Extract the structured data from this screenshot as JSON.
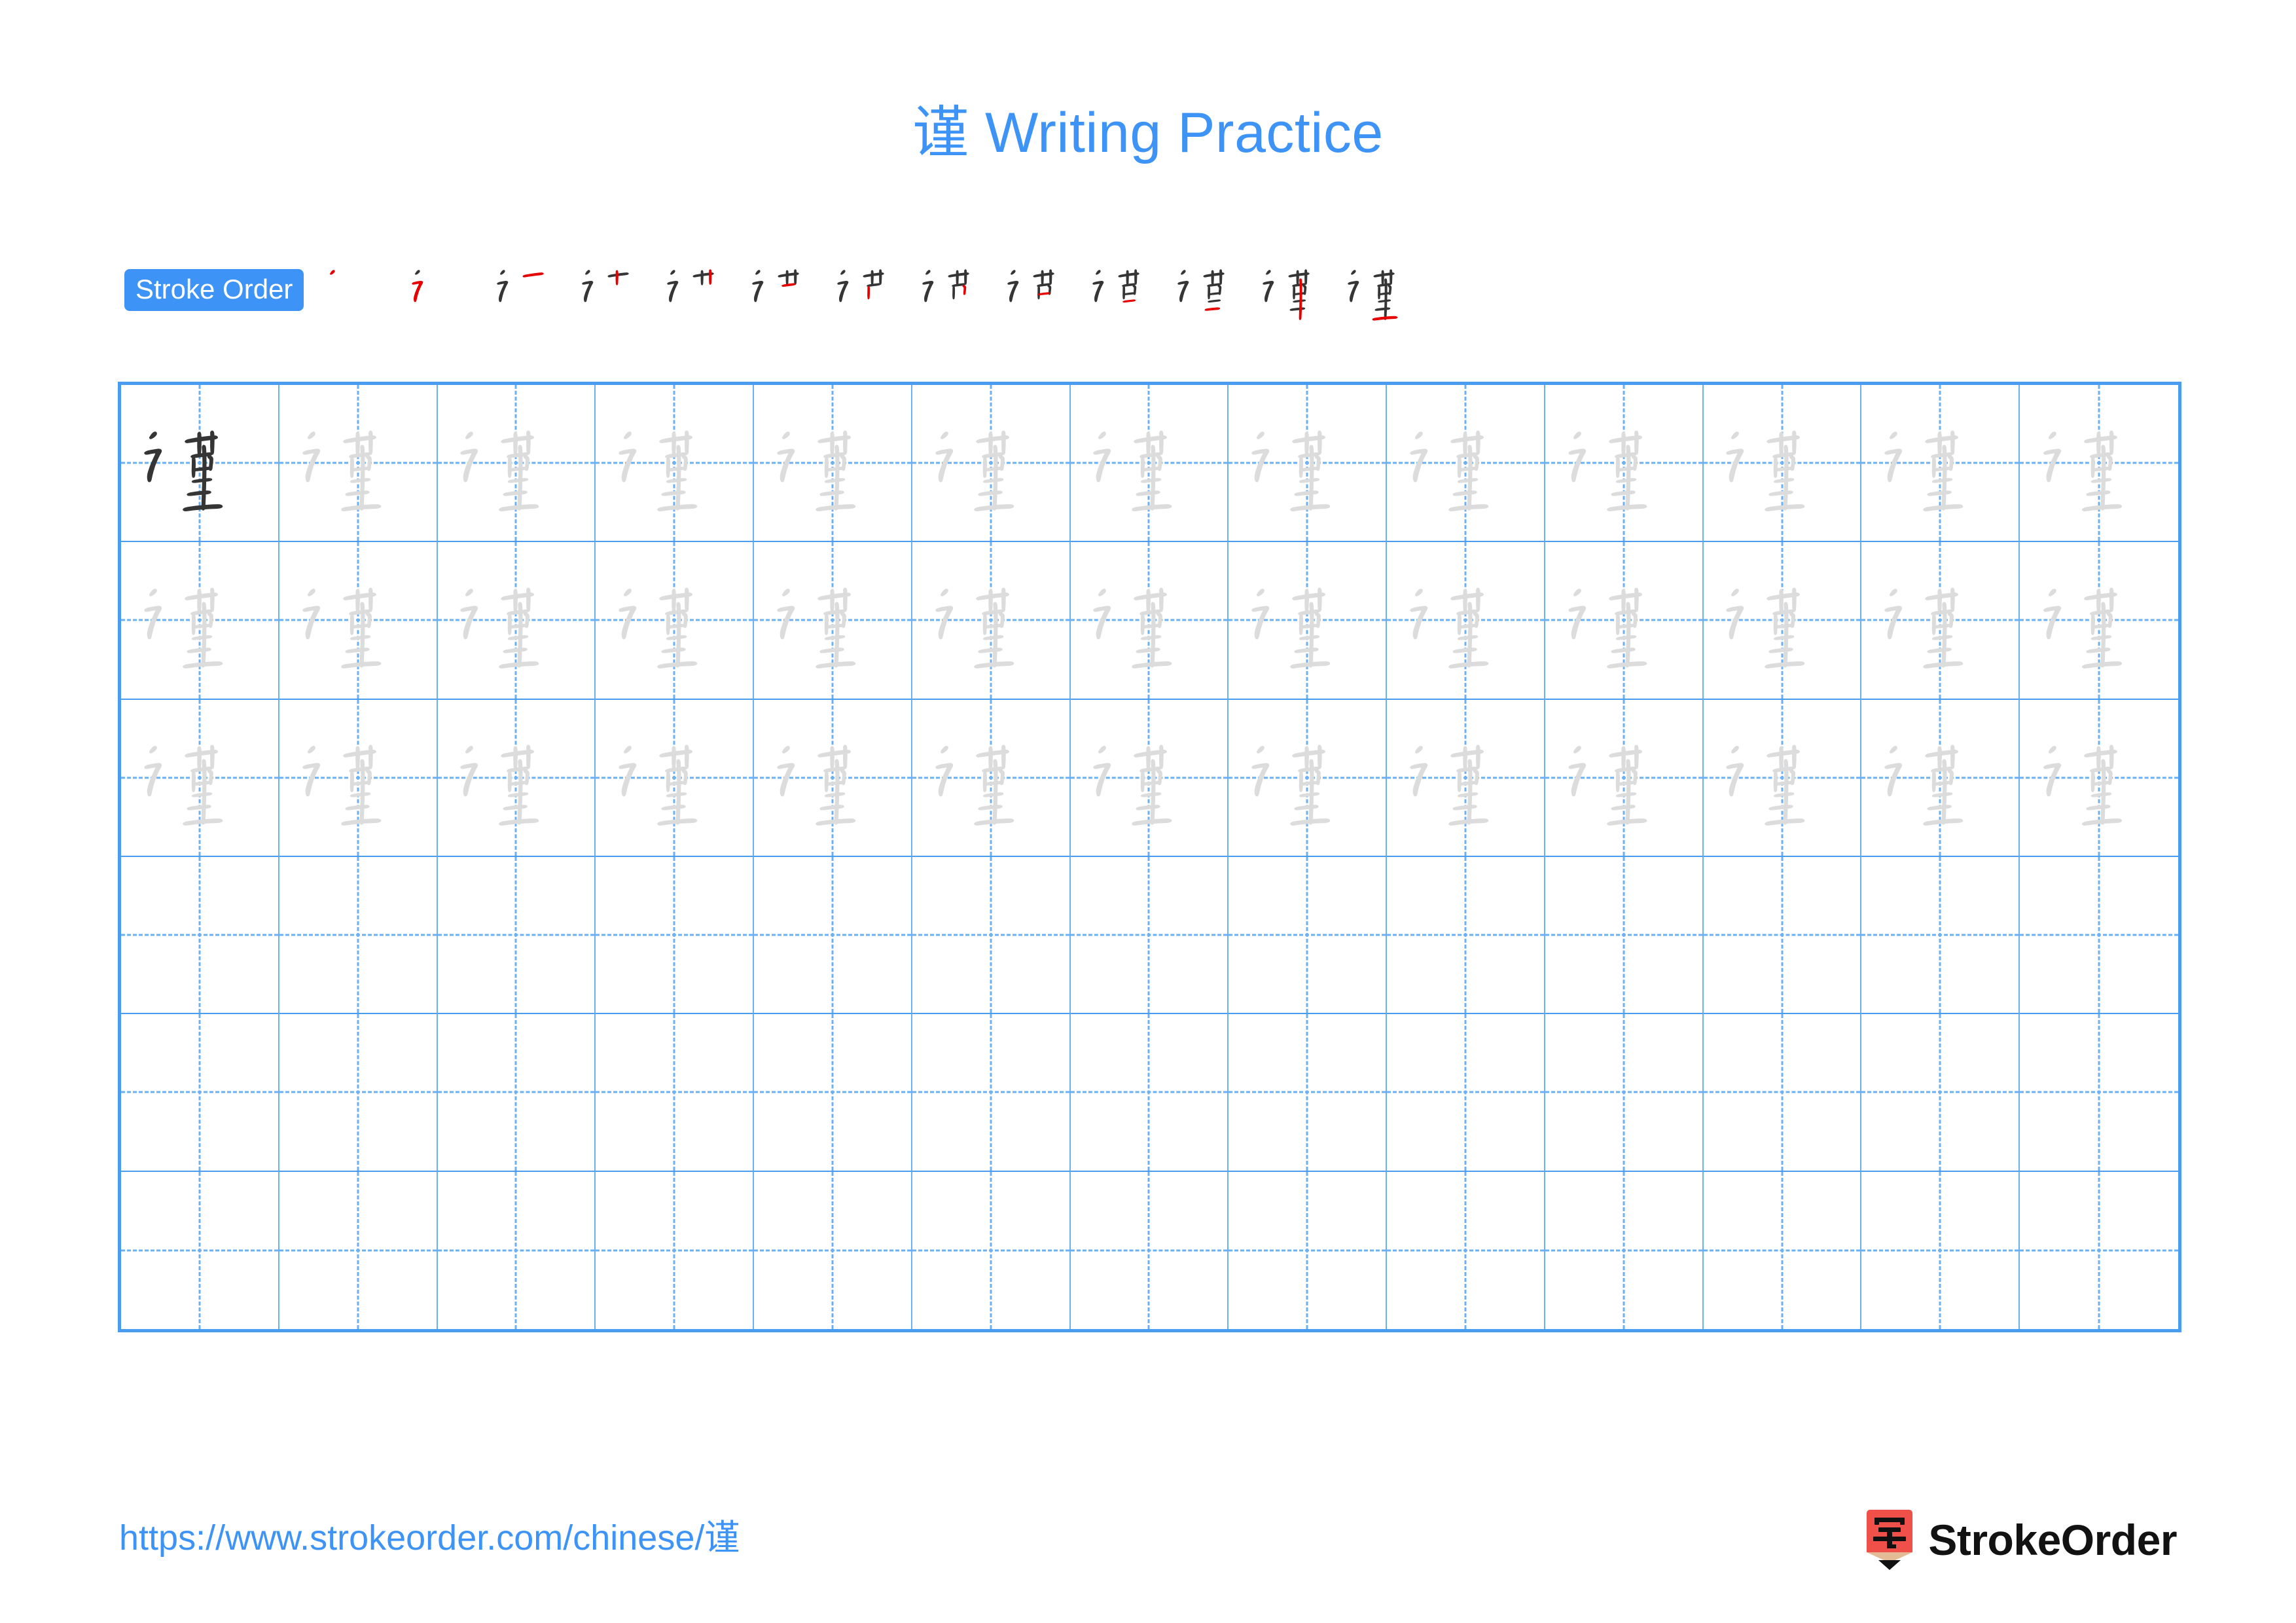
{
  "header": {
    "title": "谨 Writing Practice",
    "title_color": "#3d94f6"
  },
  "stroke_order": {
    "badge_label": "Stroke Order",
    "badge_bg": "#3d94f6",
    "badge_text_color": "#ffffff",
    "character": "谨",
    "total_strokes": 13,
    "new_stroke_color": "#e60000",
    "prior_stroke_color": "#353535",
    "steps": [
      {
        "index": 1,
        "strokes_shown": 1
      },
      {
        "index": 2,
        "strokes_shown": 2
      },
      {
        "index": 3,
        "strokes_shown": 3
      },
      {
        "index": 4,
        "strokes_shown": 4
      },
      {
        "index": 5,
        "strokes_shown": 5
      },
      {
        "index": 6,
        "strokes_shown": 6
      },
      {
        "index": 7,
        "strokes_shown": 7
      },
      {
        "index": 8,
        "strokes_shown": 8
      },
      {
        "index": 9,
        "strokes_shown": 9
      },
      {
        "index": 10,
        "strokes_shown": 10
      },
      {
        "index": 11,
        "strokes_shown": 11
      },
      {
        "index": 12,
        "strokes_shown": 12
      },
      {
        "index": 13,
        "strokes_shown": 13
      }
    ]
  },
  "practice_grid": {
    "columns": 13,
    "rows": 6,
    "character": "谨",
    "grid_line_color": "#4a9cf0",
    "guide_line_color": "#6cb0f4",
    "model_char_color": "#353535",
    "trace_char_color": "#dcdcdc",
    "rows_data": [
      {
        "row": 1,
        "cells": [
          "model",
          "trace",
          "trace",
          "trace",
          "trace",
          "trace",
          "trace",
          "trace",
          "trace",
          "trace",
          "trace",
          "trace",
          "trace"
        ]
      },
      {
        "row": 2,
        "cells": [
          "trace",
          "trace",
          "trace",
          "trace",
          "trace",
          "trace",
          "trace",
          "trace",
          "trace",
          "trace",
          "trace",
          "trace",
          "trace"
        ]
      },
      {
        "row": 3,
        "cells": [
          "trace",
          "trace",
          "trace",
          "trace",
          "trace",
          "trace",
          "trace",
          "trace",
          "trace",
          "trace",
          "trace",
          "trace",
          "trace"
        ]
      },
      {
        "row": 4,
        "cells": [
          "empty",
          "empty",
          "empty",
          "empty",
          "empty",
          "empty",
          "empty",
          "empty",
          "empty",
          "empty",
          "empty",
          "empty",
          "empty"
        ]
      },
      {
        "row": 5,
        "cells": [
          "empty",
          "empty",
          "empty",
          "empty",
          "empty",
          "empty",
          "empty",
          "empty",
          "empty",
          "empty",
          "empty",
          "empty",
          "empty"
        ]
      },
      {
        "row": 6,
        "cells": [
          "empty",
          "empty",
          "empty",
          "empty",
          "empty",
          "empty",
          "empty",
          "empty",
          "empty",
          "empty",
          "empty",
          "empty",
          "empty"
        ]
      }
    ]
  },
  "footer": {
    "url": "https://www.strokeorder.com/chinese/谨",
    "url_color": "#3d94f6",
    "brand_name": "StrokeOrder",
    "brand_logo_char": "字",
    "brand_logo_bg": "#f0504a",
    "brand_logo_tip": "#e3bc95"
  }
}
